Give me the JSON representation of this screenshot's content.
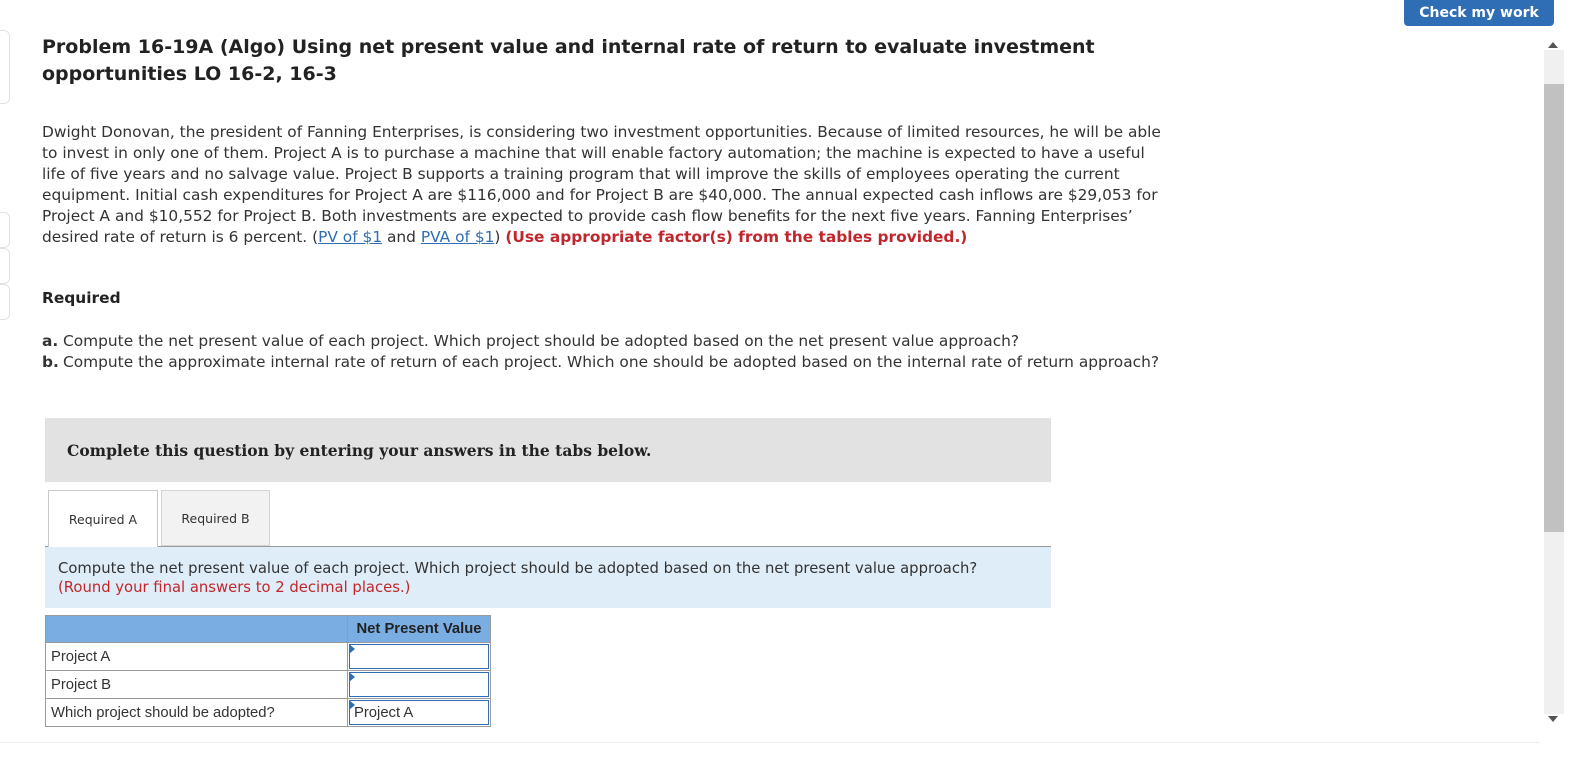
{
  "header": {
    "check_button": "Check my work"
  },
  "problem": {
    "title": "Problem 16-19A (Algo) Using net present value and internal rate of return to evaluate investment opportunities LO 16-2, 16-3",
    "text_main": "Dwight Donovan, the president of Fanning Enterprises, is considering two investment opportunities. Because of limited resources, he will be able to invest in only one of them. Project A is to purchase a machine that will enable factory automation; the machine is expected to have a useful life of five years and no salvage value. Project B supports a training program that will improve the skills of employees operating the current equipment. Initial cash expenditures for Project A are $116,000 and for Project B are $40,000. The annual expected cash inflows are $29,053 for Project A and $10,552 for Project B. Both investments are expected to provide cash flow benefits for the next five years. Fanning Enterprises’ desired rate of return is 6 percent. (",
    "link_pv": "PV of $1",
    "text_and": " and ",
    "link_pva": "PVA of $1",
    "text_close": ") ",
    "emphasis": "(Use appropriate factor(s) from the tables provided.)"
  },
  "required": {
    "heading": "Required",
    "items": [
      {
        "letter": "a.",
        "text": "Compute the net present value of each project. Which project should be adopted based on the net present value approach?"
      },
      {
        "letter": "b.",
        "text": "Compute the approximate internal rate of return of each project. Which one should be adopted based on the internal rate of return approach?"
      }
    ]
  },
  "instructions": "Complete this question by entering your answers in the tabs below.",
  "tabs": [
    {
      "label": "Required A",
      "active": true
    },
    {
      "label": "Required B",
      "active": false
    }
  ],
  "question": {
    "text": "Compute the net present value of each project. Which project should be adopted based on the net present value approach?",
    "hint": "(Round your final answers to 2 decimal places.)"
  },
  "table": {
    "header": "Net Present Value",
    "rows": [
      {
        "label": "Project A",
        "value": ""
      },
      {
        "label": "Project B",
        "value": ""
      },
      {
        "label": "Which project should be adopted?",
        "value": "Project A"
      }
    ]
  },
  "colors": {
    "accent": "#2f6db5",
    "table_header": "#7aaee3",
    "hint_red": "#c0272d",
    "question_bg": "#deedf8"
  }
}
